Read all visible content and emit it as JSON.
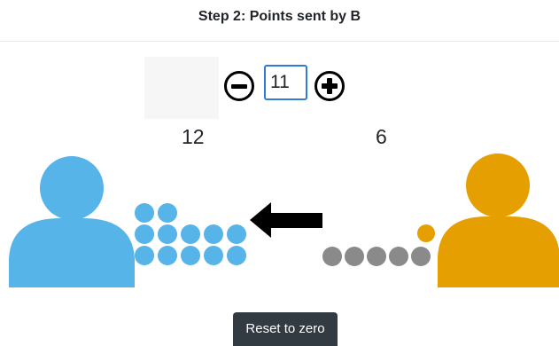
{
  "header": {
    "title": "Step 2: Points sent by B"
  },
  "transfer": {
    "value": "11"
  },
  "players": {
    "a": {
      "score": "12",
      "color": "#56b4e9"
    },
    "b": {
      "score": "6",
      "color": "#e69f00"
    }
  },
  "tokens": {
    "a_count": 12,
    "b_count": 5,
    "token_color_b": "#8a8a8a",
    "in_transit": 1
  },
  "buttons": {
    "reset_label": "Reset to zero"
  },
  "icons": {
    "minus": "minus-circle-icon",
    "plus": "plus-circle-icon",
    "arrow": "left-arrow-icon"
  }
}
